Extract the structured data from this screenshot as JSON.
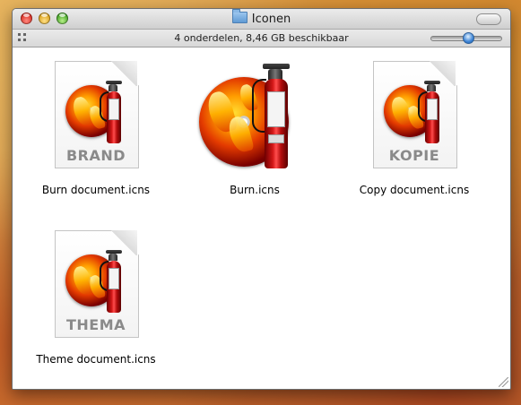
{
  "window": {
    "title": "Iconen",
    "status": "4 onderdelen, 8,46 GB beschikbaar"
  },
  "icons": {
    "folder": "folder-icon",
    "document": "document-icon",
    "extinguisher": "fire-extinguisher-icon"
  },
  "files": [
    {
      "name": "Burn document.icns",
      "badge": "BRAND"
    },
    {
      "name": "Burn.icns"
    },
    {
      "name": "Copy document.icns",
      "badge": "KOPIE"
    },
    {
      "name": "Theme document.icns",
      "badge": "THEMA"
    }
  ],
  "colors": {
    "accent": "#3d84d6",
    "close": "#d6271c",
    "minimize": "#d79c13",
    "zoom": "#3a9c1d"
  }
}
